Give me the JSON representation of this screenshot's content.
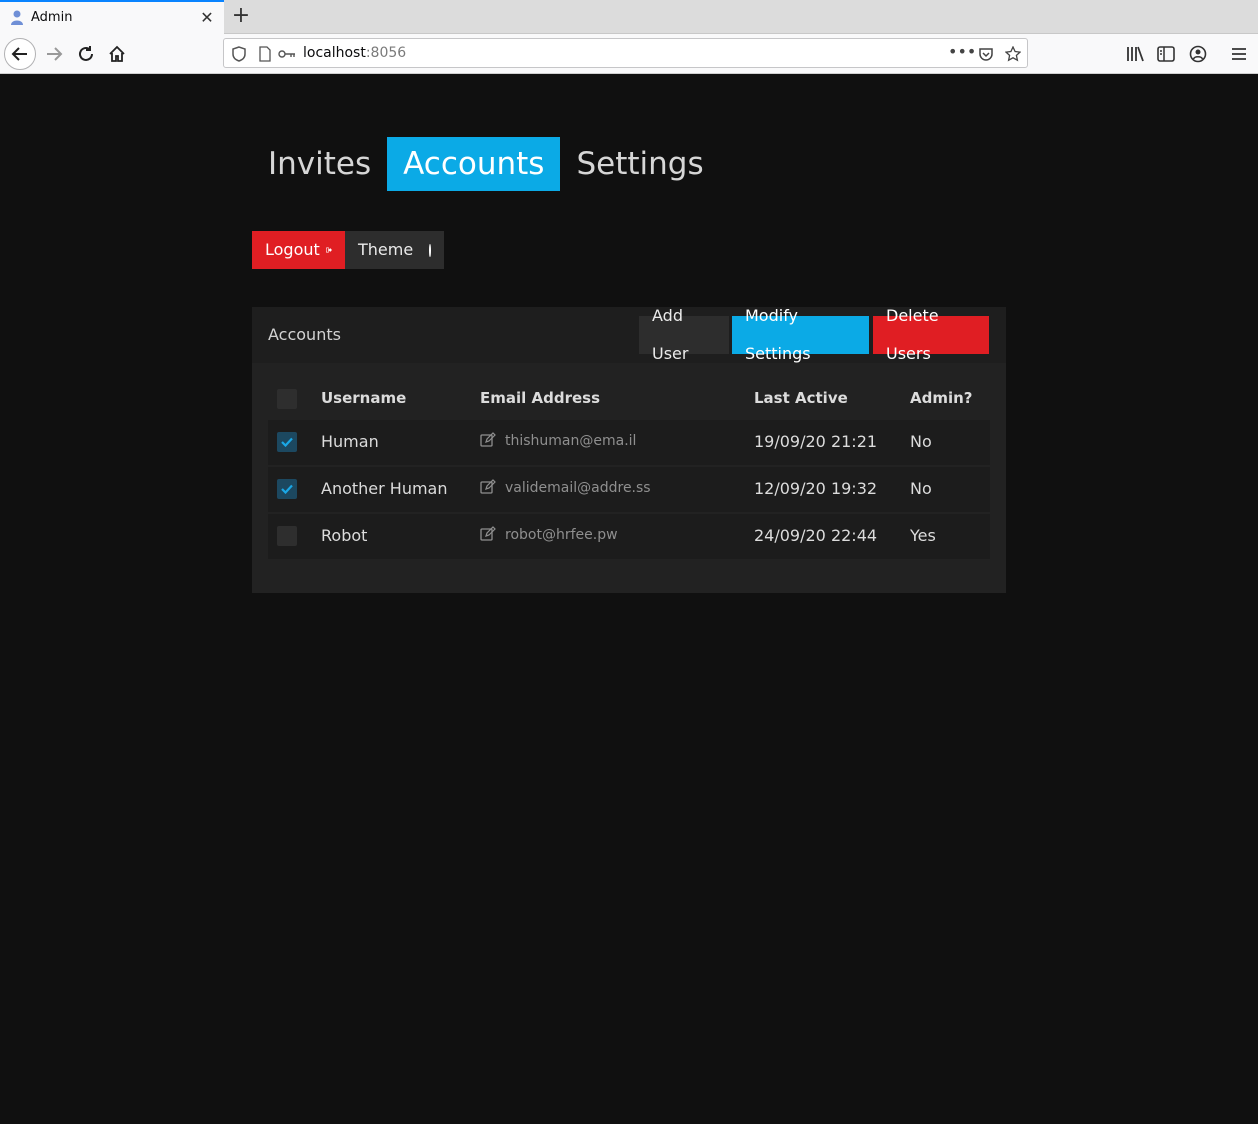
{
  "browser": {
    "tab_title": "Admin",
    "url_host": "localhost",
    "url_port": ":8056"
  },
  "nav": {
    "tabs": [
      {
        "label": "Invites",
        "active": false
      },
      {
        "label": "Accounts",
        "active": true
      },
      {
        "label": "Settings",
        "active": false
      }
    ]
  },
  "actions": {
    "logout_label": "Logout",
    "theme_label": "Theme"
  },
  "accounts": {
    "title": "Accounts",
    "add_user_label": "Add User",
    "modify_settings_label": "Modify Settings",
    "delete_users_label": "Delete Users",
    "columns": [
      "Username",
      "Email Address",
      "Last Active",
      "Admin?"
    ],
    "rows": [
      {
        "checked": true,
        "username": "Human",
        "email": "thishuman@ema.il",
        "last_active": "19/09/20 21:21",
        "admin": "No"
      },
      {
        "checked": true,
        "username": "Another Human",
        "email": "validemail@addre.ss",
        "last_active": "12/09/20 19:32",
        "admin": "No"
      },
      {
        "checked": false,
        "username": "Robot",
        "email": "robot@hrfee.pw",
        "last_active": "24/09/20 22:44",
        "admin": "Yes"
      }
    ]
  },
  "colors": {
    "accent_blue": "#0baae6",
    "danger_red": "#e01e23",
    "background": "#101010",
    "card": "#222222"
  }
}
